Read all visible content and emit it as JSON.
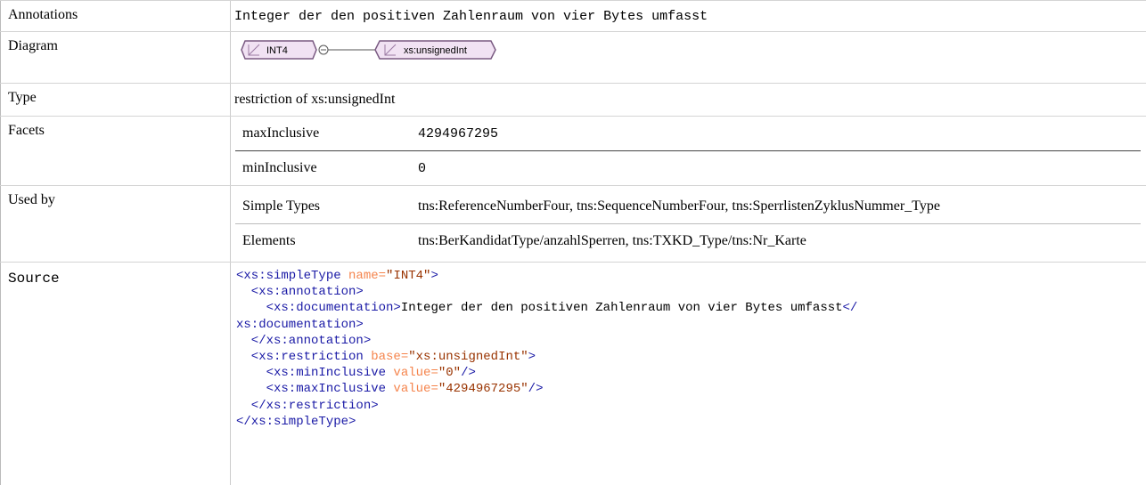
{
  "rows": {
    "annotations": {
      "label": "Annotations",
      "value": "Integer der den positiven Zahlenraum von vier Bytes umfasst"
    },
    "diagram": {
      "label": "Diagram",
      "node_left": "INT4",
      "node_right": "xs:unsignedInt"
    },
    "type": {
      "label": "Type",
      "value": "restriction of xs:unsignedInt"
    },
    "facets": {
      "label": "Facets",
      "items": [
        {
          "key": "maxInclusive",
          "value": "4294967295"
        },
        {
          "key": "minInclusive",
          "value": "0"
        }
      ]
    },
    "used_by": {
      "label": "Used by",
      "items": [
        {
          "key": "Simple Types",
          "value": "tns:ReferenceNumberFour, tns:SequenceNumberFour, tns:SperrlistenZyklusNummer_Type"
        },
        {
          "key": "Elements",
          "value": "tns:BerKandidatType/anzahlSperren, tns:TXKD_Type/tns:Nr_Karte"
        }
      ]
    },
    "source": {
      "label": "Source",
      "lines": {
        "l1_open": "<xs:simpleType",
        "l1_attr": " name=",
        "l1_val": "\"INT4\"",
        "l1_close": ">",
        "l2": "  <xs:annotation>",
        "l3_open": "    <xs:documentation>",
        "l3_text": "Integer der den positiven Zahlenraum von vier Bytes umfasst",
        "l3_close": "</",
        "l4": "xs:documentation>",
        "l5": "  </xs:annotation>",
        "l6_open": "  <xs:restriction",
        "l6_attr": " base=",
        "l6_val": "\"xs:unsignedInt\"",
        "l6_close": ">",
        "l7_open": "    <xs:minInclusive",
        "l7_attr": " value=",
        "l7_val": "\"0\"",
        "l7_close": "/>",
        "l8_open": "    <xs:maxInclusive",
        "l8_attr": " value=",
        "l8_val": "\"4294967295\"",
        "l8_close": "/>",
        "l9": "  </xs:restriction>",
        "l10": "</xs:simpleType>"
      }
    }
  },
  "colors": {
    "node_fill": "#f1e2f3",
    "node_border": "#7a5a82",
    "tag": "#1a1aa6",
    "attr": "#f5844c",
    "attr_value": "#993300"
  }
}
